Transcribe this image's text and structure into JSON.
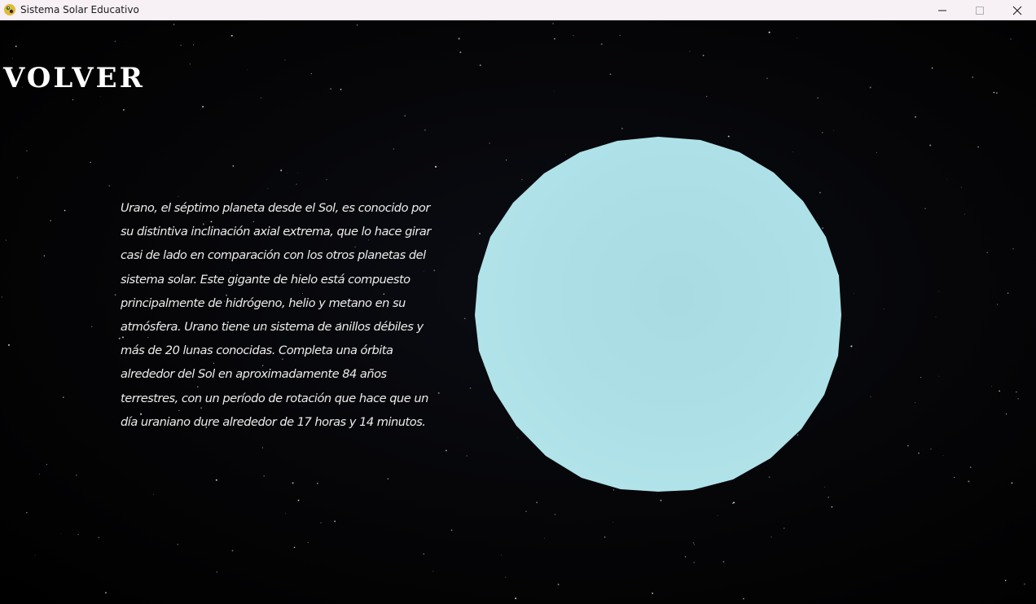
{
  "window": {
    "title": "Sistema Solar Educativo",
    "controls": {
      "minimize": "minimize-icon",
      "maximize": "maximize-icon",
      "close": "close-icon"
    }
  },
  "scene": {
    "back_label": "VOLVER",
    "planet_name": "Urano",
    "planet_color": "#b0e2e8",
    "description": "Urano, el séptimo planeta desde el Sol, es conocido por su distintiva inclinación axial extrema, que lo hace girar casi de lado en comparación con los otros planetas del sistema solar. Este gigante de hielo está compuesto principalmente de hidrógeno, helio y metano en su atmósfera. Urano tiene un sistema de anillos débiles y más de 20 lunas conocidas. Completa una órbita alrededor del Sol en aproximadamente 84 años terrestres, con un período de rotación que hace que un día uraniano dure alrededor de 17 horas y 14 minutos."
  },
  "colors": {
    "background": "#000000",
    "titlebar": "#f7f1f5",
    "text": "#ececec"
  }
}
